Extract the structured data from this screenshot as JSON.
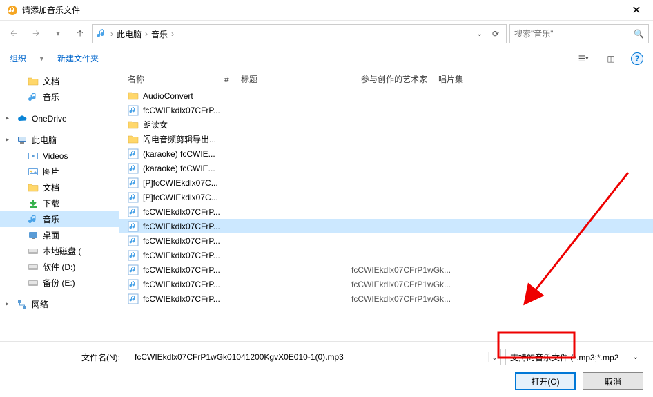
{
  "title": "请添加音乐文件",
  "breadcrumb": {
    "root": "此电脑",
    "folder": "音乐"
  },
  "search": {
    "placeholder": "搜索\"音乐\""
  },
  "toolbar": {
    "organize": "组织",
    "newfolder": "新建文件夹"
  },
  "sidebar": [
    {
      "label": "文档",
      "icon": "folder",
      "indent": true
    },
    {
      "label": "音乐",
      "icon": "music",
      "indent": true
    },
    {
      "label": "OneDrive",
      "icon": "onedrive",
      "caret": true
    },
    {
      "label": "此电脑",
      "icon": "thispc",
      "caret": true
    },
    {
      "label": "Videos",
      "icon": "video",
      "indent": true
    },
    {
      "label": "图片",
      "icon": "image",
      "indent": true
    },
    {
      "label": "文档",
      "icon": "folder",
      "indent": true
    },
    {
      "label": "下载",
      "icon": "download",
      "indent": true
    },
    {
      "label": "音乐",
      "icon": "music",
      "indent": true,
      "selected": true
    },
    {
      "label": "桌面",
      "icon": "desktop",
      "indent": true
    },
    {
      "label": "本地磁盘 (",
      "icon": "disk",
      "indent": true
    },
    {
      "label": "软件 (D:)",
      "icon": "disk",
      "indent": true
    },
    {
      "label": "备份 (E:)",
      "icon": "disk",
      "indent": true
    },
    {
      "label": "网络",
      "icon": "network",
      "caret": true
    }
  ],
  "columns": {
    "name": "名称",
    "num": "#",
    "title": "标题",
    "artist": "参与创作的艺术家",
    "album": "唱片集"
  },
  "files": [
    {
      "icon": "folder",
      "name": "AudioConvert"
    },
    {
      "icon": "audio",
      "name": "fcCWIEkdlx07CFrP..."
    },
    {
      "icon": "folder",
      "name": "朗读女"
    },
    {
      "icon": "folder",
      "name": "闪电音频剪辑导出..."
    },
    {
      "icon": "audio",
      "name": "(karaoke) fcCWIE..."
    },
    {
      "icon": "audio",
      "name": "(karaoke) fcCWIE..."
    },
    {
      "icon": "audio",
      "name": "[P]fcCWIEkdlx07C..."
    },
    {
      "icon": "audio",
      "name": "[P]fcCWIEkdlx07C..."
    },
    {
      "icon": "audio",
      "name": "fcCWIEkdlx07CFrP..."
    },
    {
      "icon": "audio",
      "name": "fcCWIEkdlx07CFrP...",
      "selected": true
    },
    {
      "icon": "audio",
      "name": "fcCWIEkdlx07CFrP..."
    },
    {
      "icon": "audio",
      "name": "fcCWIEkdlx07CFrP..."
    },
    {
      "icon": "audio",
      "name": "fcCWIEkdlx07CFrP...",
      "title": "fcCWIEkdlx07CFrP1wGk..."
    },
    {
      "icon": "audio",
      "name": "fcCWIEkdlx07CFrP...",
      "title": "fcCWIEkdlx07CFrP1wGk..."
    },
    {
      "icon": "audio",
      "name": "fcCWIEkdlx07CFrP...",
      "title": "fcCWIEkdlx07CFrP1wGk..."
    }
  ],
  "footer": {
    "filenamelabel": "文件名(N):",
    "filename": "fcCWIEkdlx07CFrP1wGk01041200KgvX0E010-1(0).mp3",
    "filter": "支持的音乐文件 (*.mp3;*.mp2",
    "open": "打开(O)",
    "cancel": "取消"
  }
}
